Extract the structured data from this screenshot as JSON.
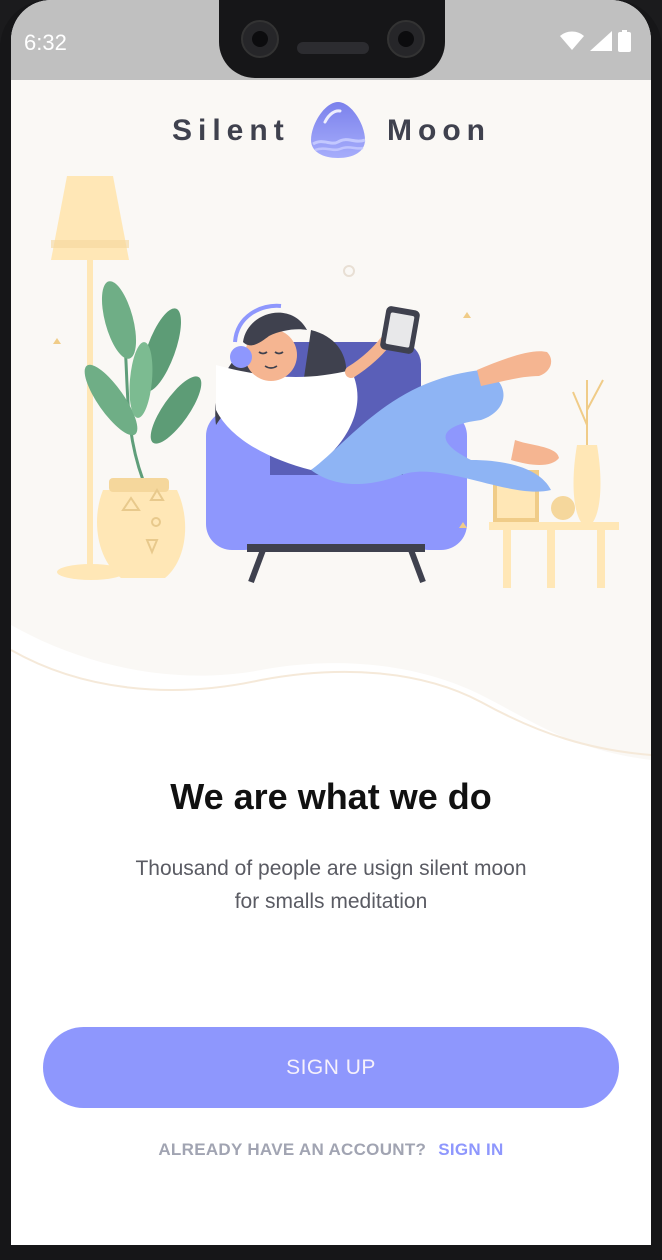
{
  "status_bar": {
    "time": "6:32",
    "icons": [
      "wifi-icon",
      "signal-icon",
      "battery-icon"
    ]
  },
  "brand": {
    "left_word": "Silent",
    "right_word": "Moon",
    "logo": "moon-logo-icon"
  },
  "illustration": {
    "subject": "woman-relaxing-in-armchair-illustration"
  },
  "onboarding": {
    "headline": "We are what we do",
    "subtitle_line1": "Thousand of people are usign silent moon",
    "subtitle_line2": "for smalls meditation"
  },
  "actions": {
    "signup_label": "SIGN UP",
    "already_label": "ALREADY HAVE AN ACCOUNT?",
    "signin_label": "SIGN IN"
  },
  "colors": {
    "accent": "#8e97fd",
    "heading": "#3f414e",
    "muted": "#a1a4b2",
    "illustration_bg": "#faf8f5",
    "cream": "#ffe7b6"
  }
}
